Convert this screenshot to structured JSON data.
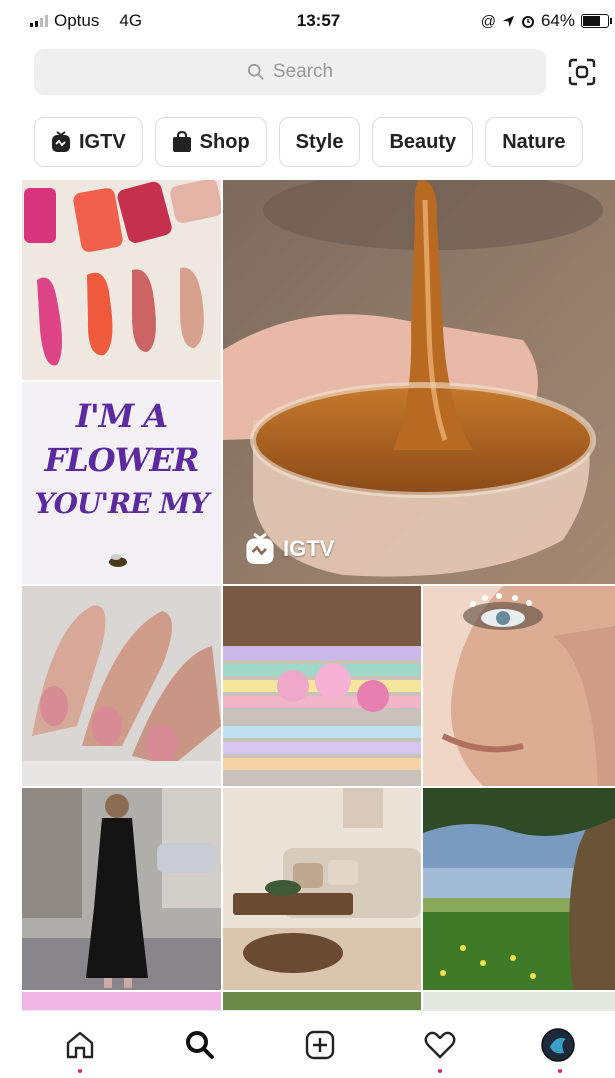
{
  "status_bar": {
    "carrier": "Optus",
    "network": "4G",
    "time": "13:57",
    "battery": "64%",
    "battery_level": 0.64,
    "icons": [
      "signal-bars-icon",
      "at-icon",
      "location-arrow-icon",
      "alarm-icon",
      "battery-icon"
    ]
  },
  "search": {
    "placeholder": "Search",
    "icons": [
      "search-icon",
      "scan-icon"
    ]
  },
  "chips": [
    {
      "label": "IGTV",
      "icon": "igtv-icon"
    },
    {
      "label": "Shop",
      "icon": "shopping-bag-icon"
    },
    {
      "label": "Style"
    },
    {
      "label": "Beauty"
    },
    {
      "label": "Nature"
    }
  ],
  "grid": {
    "featured_badge": "IGTV",
    "featured_badge_icon": "igtv-icon",
    "tiles": [
      {
        "name": "lipstick-swatches"
      },
      {
        "name": "flower-text-art"
      },
      {
        "name": "caramel-slime-video"
      },
      {
        "name": "pink-nails"
      },
      {
        "name": "pastel-bench"
      },
      {
        "name": "face-gems-makeup"
      },
      {
        "name": "street-style-dress"
      },
      {
        "name": "living-room"
      },
      {
        "name": "tree-landscape"
      }
    ],
    "flower_art_lines": [
      "I'M A",
      "FLOWER",
      "YOU'RE MY"
    ]
  },
  "tab_bar": {
    "items": [
      {
        "name": "home",
        "icon": "home-icon",
        "notification_dot": true
      },
      {
        "name": "search",
        "icon": "search-icon",
        "active": true
      },
      {
        "name": "new-post",
        "icon": "add-post-icon"
      },
      {
        "name": "activity",
        "icon": "heart-icon",
        "notification_dot": true
      },
      {
        "name": "profile",
        "icon": "profile-avatar-icon",
        "notification_dot": true
      }
    ]
  },
  "colors": {
    "chip_border": "#dcdcdc",
    "search_bg": "#efefef",
    "notification_dot": "#e0245e"
  }
}
